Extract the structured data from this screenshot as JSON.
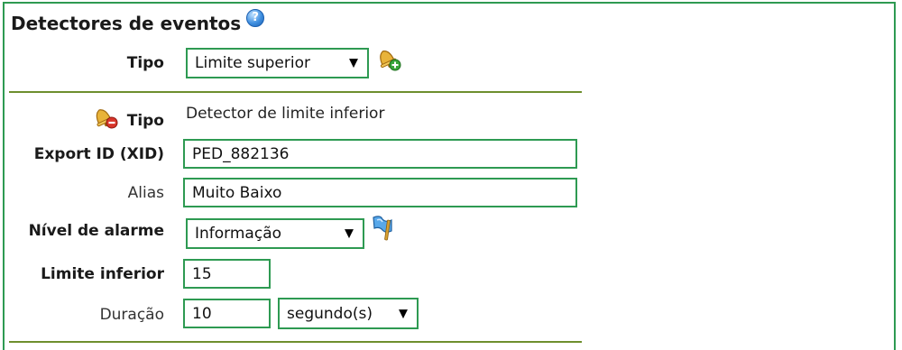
{
  "section": {
    "title": "Detectores de eventos"
  },
  "type_row": {
    "label": "Tipo",
    "selected": "Limite superior",
    "caret": "▼"
  },
  "detector": {
    "type_label": "Tipo",
    "type_value": "Detector de limite inferior",
    "xid_label": "Export ID (XID)",
    "xid_value": "PED_882136",
    "alias_label": "Alias",
    "alias_value": "Muito Baixo",
    "alarm_label": "Nível de alarme",
    "alarm_selected": "Informação",
    "limit_label": "Limite inferior",
    "limit_value": "15",
    "duration_label": "Duração",
    "duration_value": "10",
    "duration_unit": "segundo(s)",
    "caret": "▼"
  },
  "icons": {
    "help": "help-icon",
    "add_detector": "bell-add-icon",
    "remove_detector": "bell-delete-icon",
    "alarm_flag": "flag-icon"
  },
  "colors": {
    "border_green": "#2e9a52",
    "separator": "#6e8f2e"
  }
}
